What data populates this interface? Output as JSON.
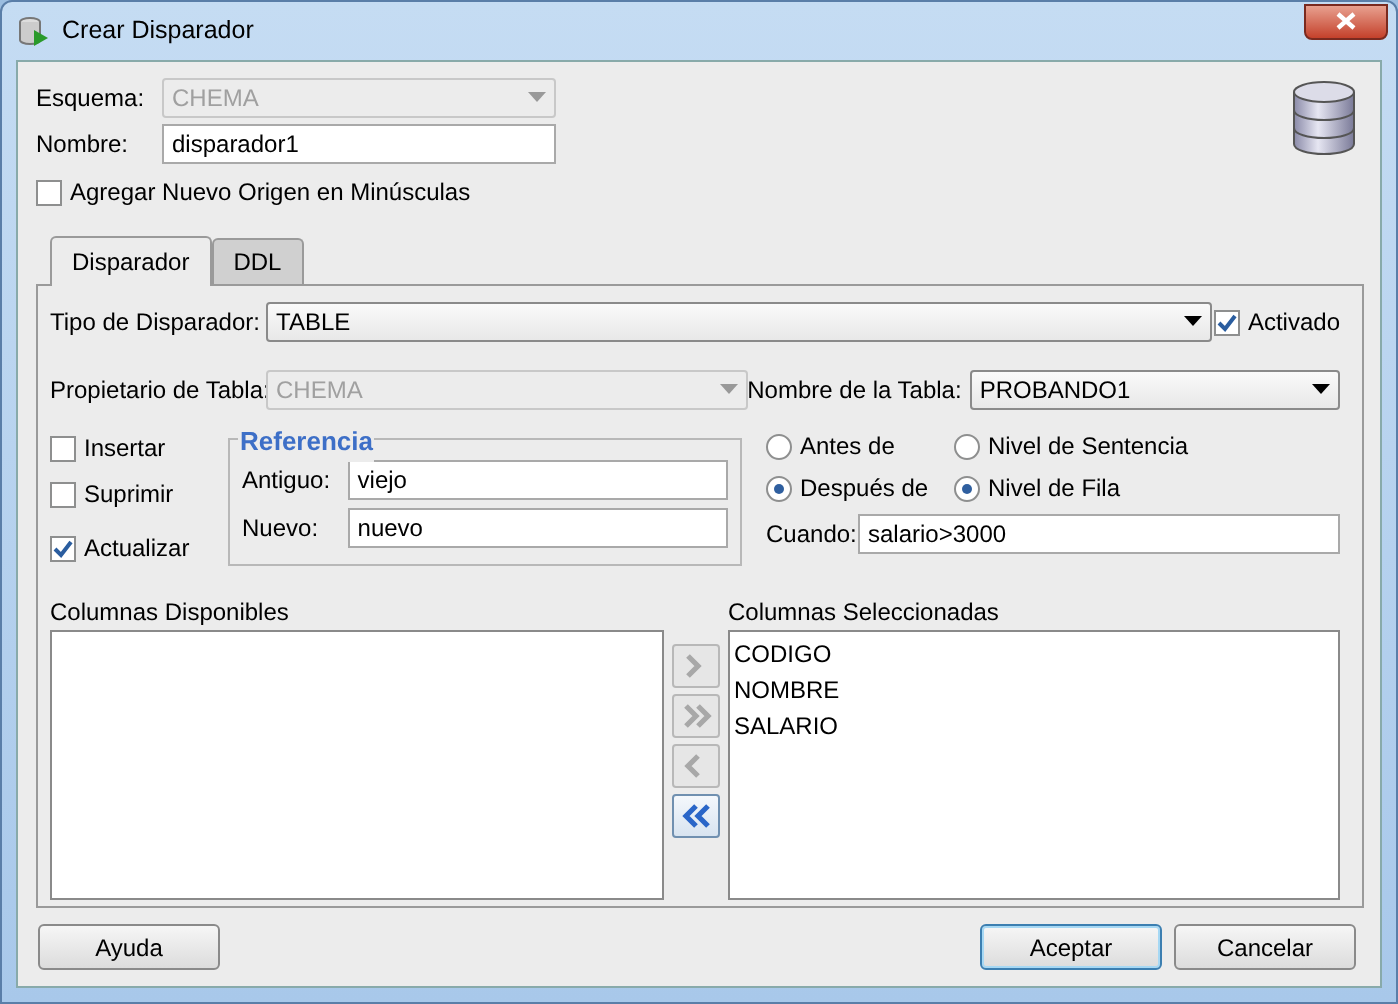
{
  "window": {
    "title": "Crear Disparador"
  },
  "schema": {
    "label": "Esquema:",
    "value": "CHEMA",
    "disabled": true
  },
  "name": {
    "label": "Nombre:",
    "value": "disparador1"
  },
  "lowercase": {
    "label": "Agregar Nuevo Origen en Minúsculas",
    "checked": false
  },
  "tabs": [
    {
      "label": "Disparador",
      "selected": true
    },
    {
      "label": "DDL",
      "selected": false
    }
  ],
  "trigger_type": {
    "label": "Tipo de Disparador:",
    "value": "TABLE"
  },
  "enabled": {
    "label": "Activado",
    "checked": true
  },
  "table_owner": {
    "label": "Propietario de Tabla:",
    "value": "CHEMA",
    "disabled": true
  },
  "table_name": {
    "label": "Nombre de la Tabla:",
    "value": "PROBANDO1"
  },
  "events": [
    {
      "label": "Insertar",
      "checked": false
    },
    {
      "label": "Suprimir",
      "checked": false
    },
    {
      "label": "Actualizar",
      "checked": true
    }
  ],
  "reference": {
    "title": "Referencia",
    "old_label": "Antiguo:",
    "old_value": "viejo",
    "new_label": "Nuevo:",
    "new_value": "nuevo"
  },
  "timing": [
    {
      "label": "Antes de",
      "selected": false
    },
    {
      "label": "Después de",
      "selected": true
    }
  ],
  "level": [
    {
      "label": "Nivel de Sentencia",
      "selected": false
    },
    {
      "label": "Nivel de Fila",
      "selected": true
    }
  ],
  "when": {
    "label": "Cuando:",
    "value": "salario>3000"
  },
  "available": {
    "label": "Columnas Disponibles"
  },
  "selected_columns": {
    "label": "Columnas Seleccionadas",
    "items": [
      "CODIGO",
      "NOMBRE",
      "SALARIO"
    ]
  },
  "move_buttons": [
    {
      "kind": "add",
      "disabled": true
    },
    {
      "kind": "add_all",
      "disabled": true
    },
    {
      "kind": "remove",
      "disabled": true
    },
    {
      "kind": "remove_all",
      "disabled": false
    }
  ],
  "buttons": [
    {
      "label": "Ayuda",
      "default": false
    },
    {
      "label": "Aceptar",
      "default": true
    },
    {
      "label": "Cancelar",
      "default": false
    }
  ]
}
